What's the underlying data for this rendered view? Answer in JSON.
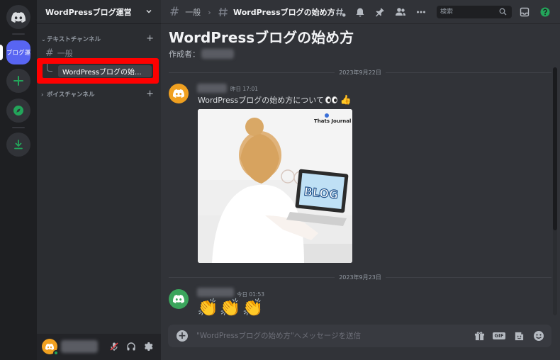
{
  "server": {
    "name": "WordPressブログ運営",
    "active_icon_label": "ブログ運"
  },
  "sidebar": {
    "categories": [
      {
        "label": "テキストチャンネル"
      },
      {
        "label": "ボイスチャンネル"
      }
    ],
    "channels": [
      {
        "name": "一般"
      }
    ],
    "threads": [
      {
        "name": "WordPressブログの始..."
      }
    ]
  },
  "topbar": {
    "parent_channel": "一般",
    "thread_title": "WordPressブログの始め方",
    "search_placeholder": "検索"
  },
  "thread": {
    "title": "WordPressブログの始め方",
    "creator_label": "作成者："
  },
  "messages": [
    {
      "date_divider": "2023年9月22日",
      "time": "昨日 17:01",
      "text": "WordPressブログの始め方について",
      "attachment": {
        "brand_text": "Thats Journal",
        "screen_text": "BLOG"
      }
    },
    {
      "date_divider": "2023年9月23日",
      "time": "今日 01:53",
      "emoji": [
        "👏",
        "👏",
        "👏"
      ]
    }
  ],
  "composer": {
    "placeholder": "\"WordPressブログの始め方\"へメッセージを送信",
    "gif_label": "GIF"
  },
  "colors": {
    "accent": "#5865f2",
    "highlight_box": "#ff0000",
    "online": "#23a55a",
    "avatar_orange": "#f0a020",
    "avatar_green": "#3ba55c"
  }
}
